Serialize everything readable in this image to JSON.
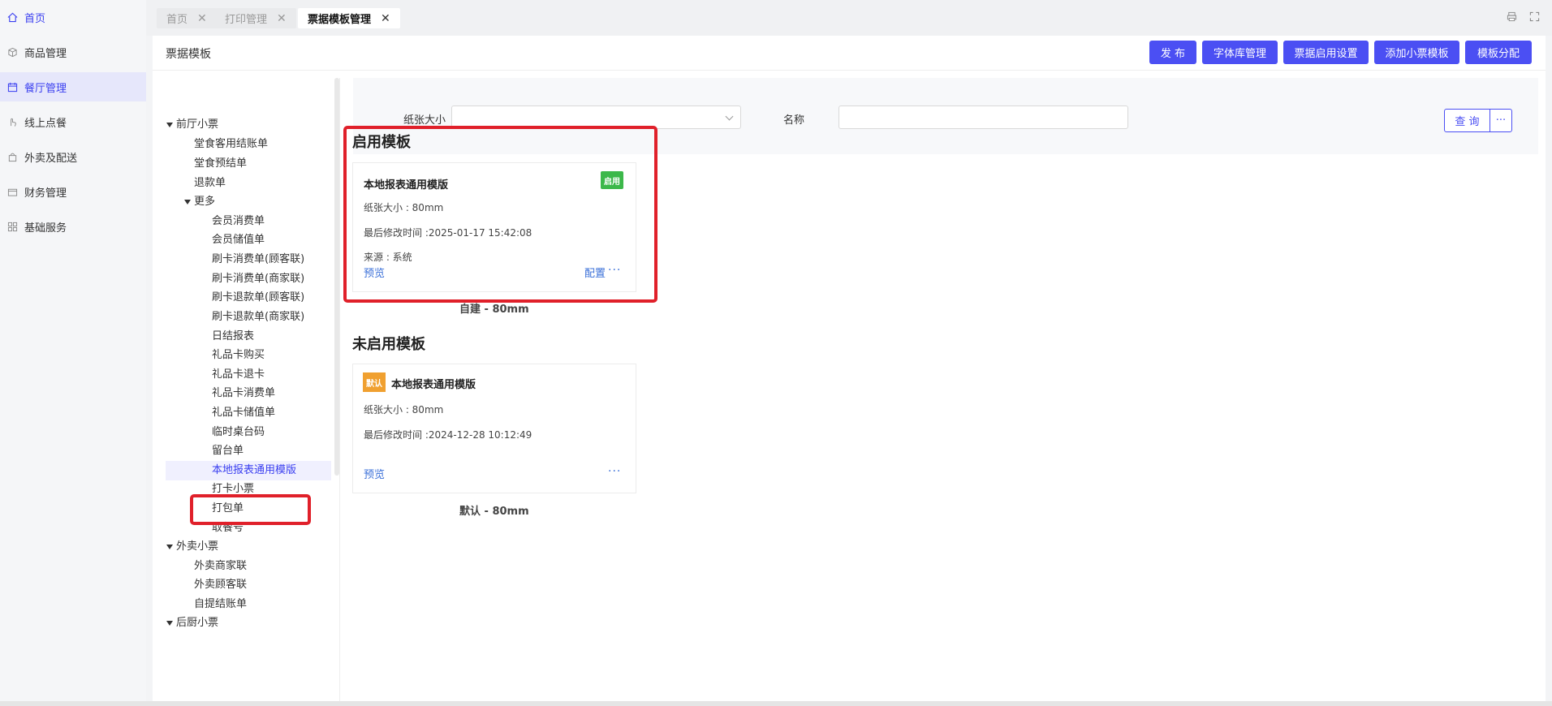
{
  "nav": {
    "items": [
      {
        "label": "首页",
        "icon": "home-icon"
      },
      {
        "label": "商品管理",
        "icon": "box-icon"
      },
      {
        "label": "餐厅管理",
        "icon": "calendar-icon"
      },
      {
        "label": "线上点餐",
        "icon": "hand-icon"
      },
      {
        "label": "外卖及配送",
        "icon": "bag-icon"
      },
      {
        "label": "财务管理",
        "icon": "wallet-icon"
      },
      {
        "label": "基础服务",
        "icon": "grid-icon"
      }
    ]
  },
  "tabs": [
    {
      "label": "首页"
    },
    {
      "label": "打印管理"
    },
    {
      "label": "票据模板管理"
    }
  ],
  "page": {
    "title": "票据模板",
    "buttons": {
      "publish": "发 布",
      "font_lib": "字体库管理",
      "ticket_enable": "票据启用设置",
      "add_ticket": "添加小票模板",
      "assign": "模板分配"
    }
  },
  "tree": {
    "front": "前厅小票",
    "dine_bill": "堂食客用结账单",
    "dine_pre": "堂食预结单",
    "refund": "退款单",
    "more": "更多",
    "member_consume": "会员消费单",
    "member_deposit": "会员储值单",
    "card_consume_cust": "刷卡消费单(顾客联)",
    "card_consume_merch": "刷卡消费单(商家联)",
    "card_refund_cust": "刷卡退款单(顾客联)",
    "card_refund_merch": "刷卡退款单(商家联)",
    "daily_report": "日结报表",
    "gift_buy": "礼品卡购买",
    "gift_return": "礼品卡退卡",
    "gift_consume": "礼品卡消费单",
    "gift_deposit": "礼品卡储值单",
    "temp_table": "临时桌台码",
    "reserve_table": "留台单",
    "local_report": "本地报表通用模版",
    "punch": "打卡小票",
    "pack": "打包单",
    "pickup": "取餐号",
    "takeout": "外卖小票",
    "takeout_merch": "外卖商家联",
    "takeout_cust": "外卖顾客联",
    "self_pick": "自提结账单",
    "kitchen": "后厨小票"
  },
  "filter": {
    "paper_label": "纸张大小",
    "paper_value": "",
    "name_label": "名称",
    "name_value": "",
    "query": "查 询",
    "more": "···"
  },
  "enabled": {
    "title": "启用模板",
    "card": {
      "name": "本地报表通用模版",
      "badge": "启用",
      "paper": "纸张大小 : 80mm",
      "modified": "最后修改时间 :2025-01-17 15:42:08",
      "source": "来源 : 系统",
      "preview": "预览",
      "config": "配置",
      "more": "···"
    },
    "caption": "自建 - 80mm"
  },
  "disabled": {
    "title": "未启用模板",
    "card": {
      "badge": "默认",
      "name": "本地报表通用模版",
      "paper": "纸张大小 : 80mm",
      "modified": "最后修改时间 :2024-12-28 10:12:49",
      "preview": "预览",
      "more": "···"
    },
    "caption": "默认 - 80mm"
  },
  "colors": {
    "accent": "#4b4ff3",
    "enabled_badge": "#3cb84a",
    "default_badge": "#f0a030",
    "highlight": "#e0202a"
  }
}
